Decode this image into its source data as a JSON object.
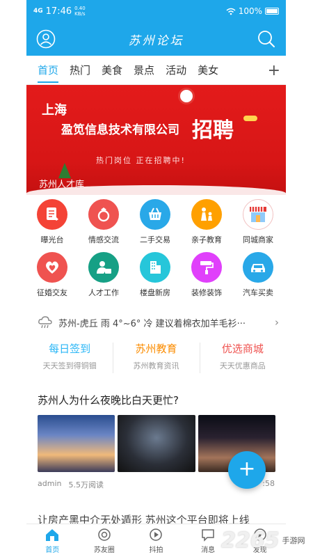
{
  "status": {
    "time": "17:46",
    "network": "4G",
    "speed": "0.40 KB/s",
    "battery": "100%"
  },
  "header": {
    "title": "苏州论坛"
  },
  "tabs": [
    {
      "label": "首页",
      "active": true
    },
    {
      "label": "热门"
    },
    {
      "label": "美食"
    },
    {
      "label": "景点"
    },
    {
      "label": "活动"
    },
    {
      "label": "美女"
    }
  ],
  "banner": {
    "city": "上海",
    "company": "盈笕信息技术有限公司",
    "headline": "招聘",
    "subtitle": "热门岗位 正在招聘中!",
    "tag": "苏州人才库"
  },
  "grid": [
    {
      "label": "曝光台",
      "icon": "exposure-icon",
      "color": "#f44336"
    },
    {
      "label": "情感交流",
      "icon": "ring-icon",
      "color": "#ef5350"
    },
    {
      "label": "二手交易",
      "icon": "basket-icon",
      "color": "#29a8e8"
    },
    {
      "label": "亲子教育",
      "icon": "family-icon",
      "color": "#ffa000"
    },
    {
      "label": "同城商家",
      "icon": "store-icon",
      "color": "#ffffff"
    },
    {
      "label": "征婚交友",
      "icon": "heart-icon",
      "color": "#ef5350"
    },
    {
      "label": "人才工作",
      "icon": "worker-icon",
      "color": "#16a085"
    },
    {
      "label": "楼盘新房",
      "icon": "building-icon",
      "color": "#26c6da"
    },
    {
      "label": "装修装饰",
      "icon": "paint-roller-icon",
      "color": "#e040fb"
    },
    {
      "label": "汽车买卖",
      "icon": "car-icon",
      "color": "#29a8e8"
    }
  ],
  "weather": {
    "text": "苏州-虎丘 雨 4°~6° 冷 建议着棉衣加羊毛衫···"
  },
  "features": [
    {
      "title": "每日签到",
      "subtitle": "天天签到得铜钿",
      "color": "#29b6f6"
    },
    {
      "title": "苏州教育",
      "subtitle": "苏州教育资讯",
      "color": "#fb8c00"
    },
    {
      "title": "优选商城",
      "subtitle": "天天优惠商品",
      "color": "#ef5350"
    }
  ],
  "article": {
    "title": "苏州人为什么夜晚比白天更忙?",
    "author": "admin",
    "reads": "5.5万阅读",
    "time": ":58"
  },
  "next_article": {
    "title": "让房产黑中介无处遁形 苏州这个平台即将上线"
  },
  "fab": {
    "label": "+"
  },
  "bottom_nav": [
    {
      "label": "首页",
      "icon": "home-icon",
      "active": true
    },
    {
      "label": "苏友圈",
      "icon": "circle-icon"
    },
    {
      "label": "抖拍",
      "icon": "play-icon"
    },
    {
      "label": "消息",
      "icon": "message-icon"
    },
    {
      "label": "发现",
      "icon": "discover-icon"
    }
  ],
  "watermark": {
    "number": "2265",
    "text": "手游网"
  },
  "colors": {
    "primary": "#1ea7ea"
  }
}
